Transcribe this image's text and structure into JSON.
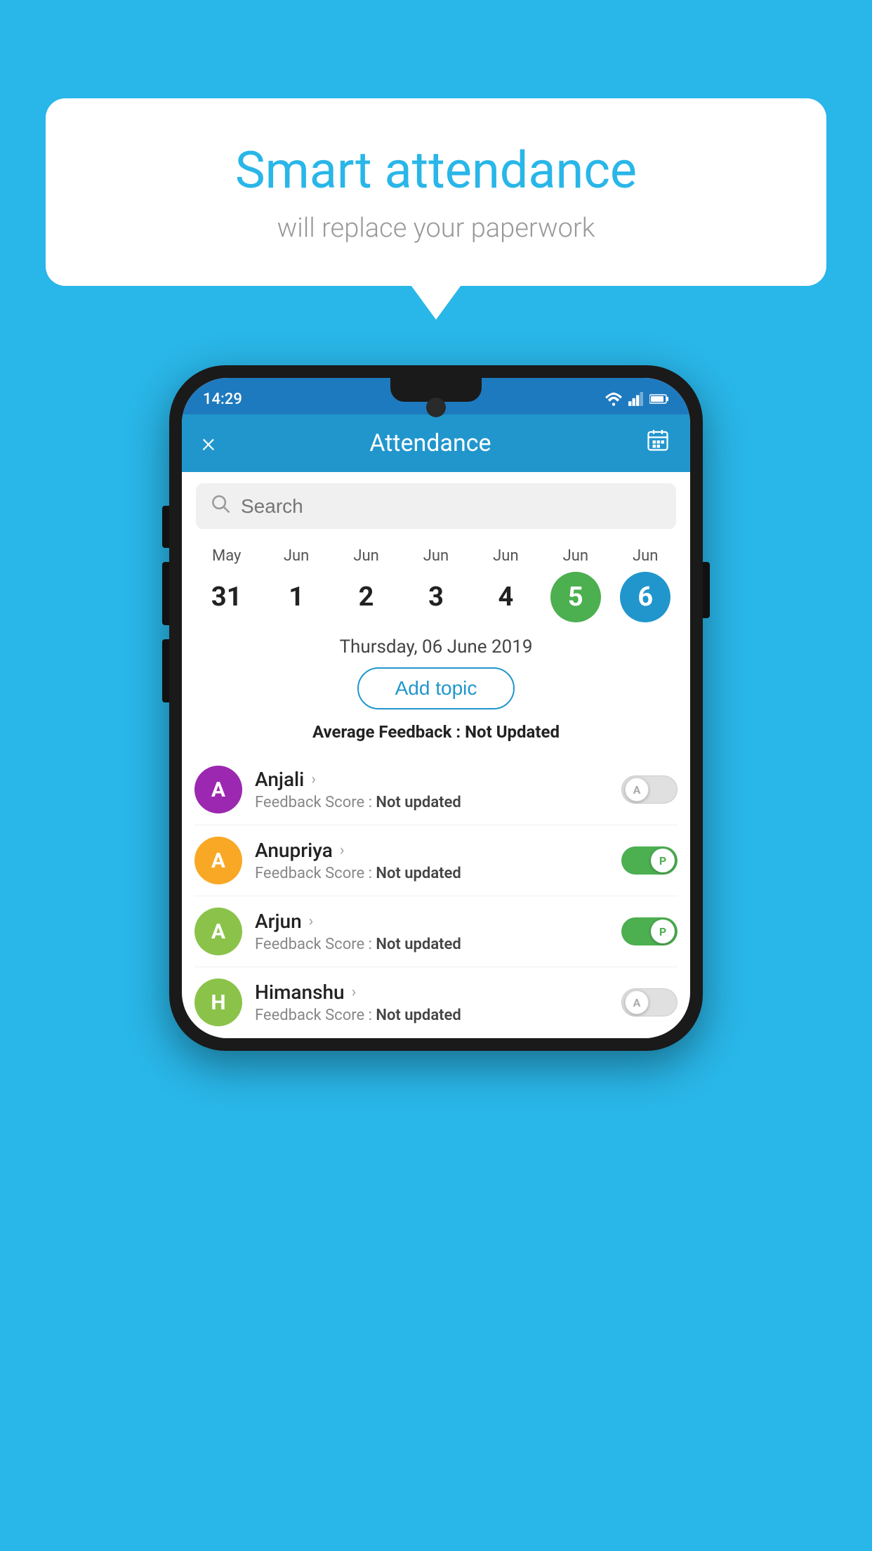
{
  "background_color": "#29b6e8",
  "bubble": {
    "title": "Smart attendance",
    "subtitle": "will replace your paperwork"
  },
  "status_bar": {
    "time": "14:29",
    "icons": [
      "wifi",
      "signal",
      "battery"
    ]
  },
  "app_bar": {
    "title": "Attendance",
    "close_label": "×",
    "calendar_icon": "📅"
  },
  "search": {
    "placeholder": "Search"
  },
  "dates": [
    {
      "month": "May",
      "day": "31",
      "state": "normal"
    },
    {
      "month": "Jun",
      "day": "1",
      "state": "normal"
    },
    {
      "month": "Jun",
      "day": "2",
      "state": "normal"
    },
    {
      "month": "Jun",
      "day": "3",
      "state": "normal"
    },
    {
      "month": "Jun",
      "day": "4",
      "state": "normal"
    },
    {
      "month": "Jun",
      "day": "5",
      "state": "today"
    },
    {
      "month": "Jun",
      "day": "6",
      "state": "selected"
    }
  ],
  "selected_date_label": "Thursday, 06 June 2019",
  "add_topic_label": "Add topic",
  "avg_feedback_label": "Average Feedback : ",
  "avg_feedback_value": "Not Updated",
  "students": [
    {
      "name": "Anjali",
      "avatar_letter": "A",
      "avatar_color": "#9c27b0",
      "feedback_label": "Feedback Score : ",
      "feedback_value": "Not updated",
      "attendance": "absent"
    },
    {
      "name": "Anupriya",
      "avatar_letter": "A",
      "avatar_color": "#f9a825",
      "feedback_label": "Feedback Score : ",
      "feedback_value": "Not updated",
      "attendance": "present"
    },
    {
      "name": "Arjun",
      "avatar_letter": "A",
      "avatar_color": "#8bc34a",
      "feedback_label": "Feedback Score : ",
      "feedback_value": "Not updated",
      "attendance": "present"
    },
    {
      "name": "Himanshu",
      "avatar_letter": "H",
      "avatar_color": "#8bc34a",
      "feedback_label": "Feedback Score : ",
      "feedback_value": "Not updated",
      "attendance": "absent"
    }
  ],
  "toggle_labels": {
    "present": "P",
    "absent": "A"
  }
}
